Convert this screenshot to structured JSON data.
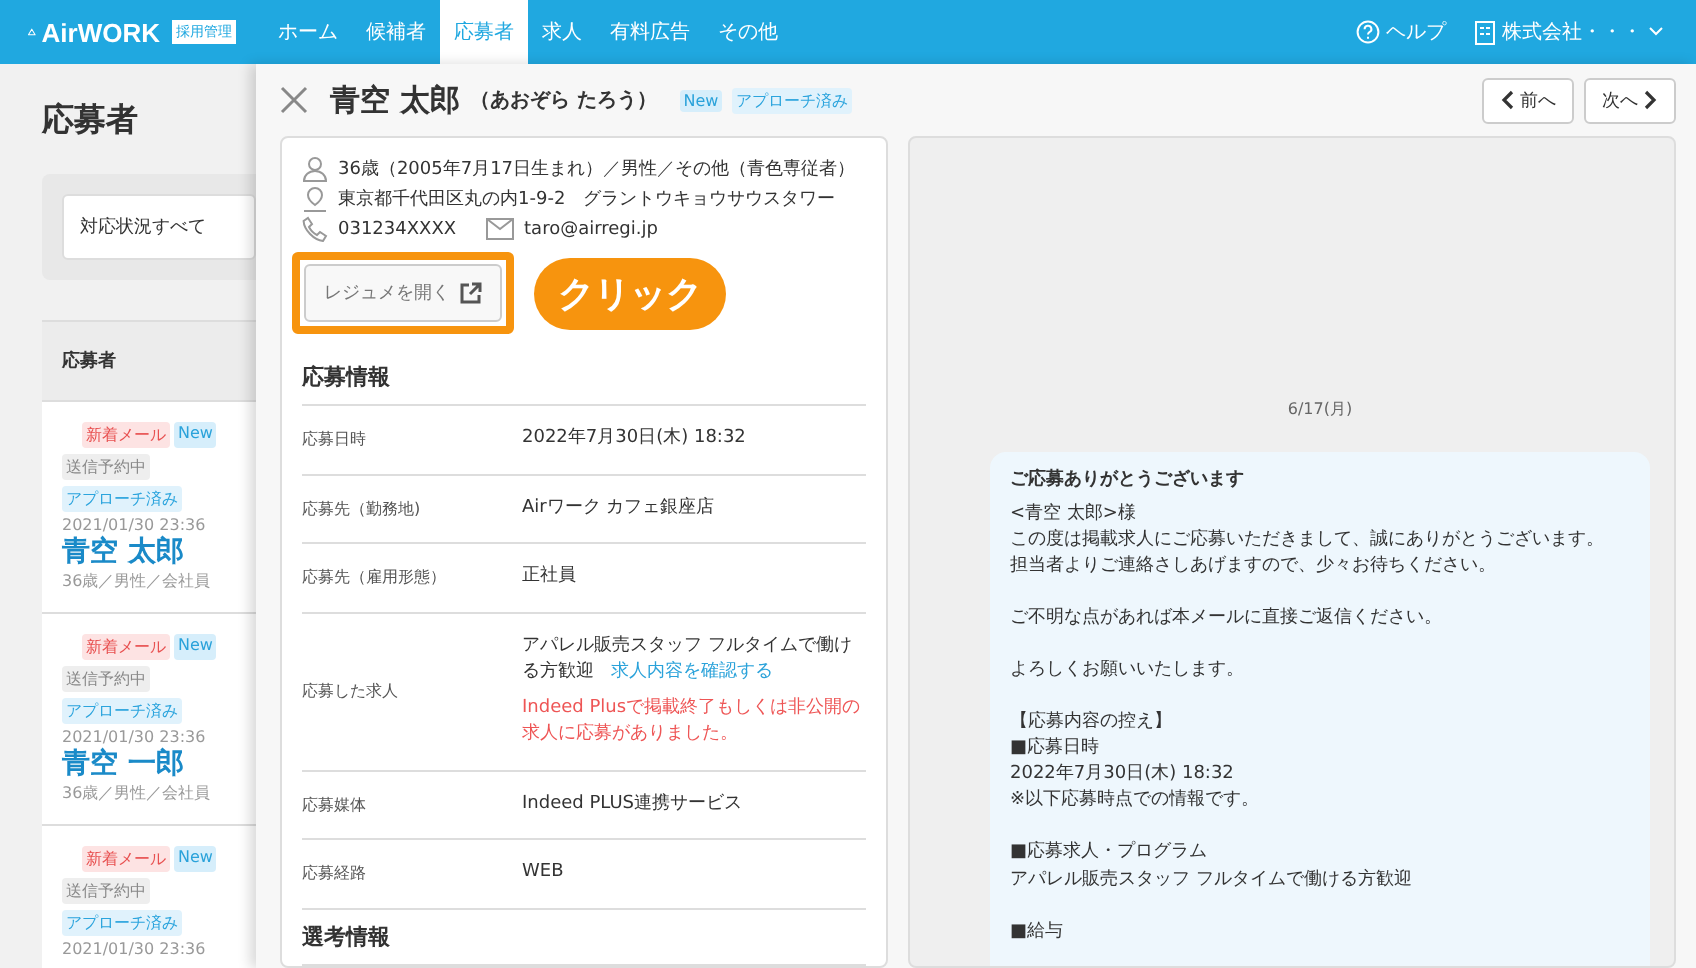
{
  "header": {
    "brand": "AirWORK",
    "brand_tag": "採用管理",
    "nav": [
      {
        "label": "ホーム",
        "selected": false
      },
      {
        "label": "候補者",
        "selected": false
      },
      {
        "label": "応募者",
        "selected": true
      },
      {
        "label": "求人",
        "selected": false
      },
      {
        "label": "有料広告",
        "selected": false
      },
      {
        "label": "その他",
        "selected": false
      }
    ],
    "help": "ヘルプ",
    "account": "株式会社・・・"
  },
  "list": {
    "title": "応募者",
    "filter": "対応状況すべて",
    "column": "応募者",
    "applicants": [
      {
        "tags": [
          {
            "label": "新着メール",
            "kind": "mail"
          },
          {
            "label": "New",
            "kind": "new"
          },
          {
            "label": "送信予約中",
            "kind": "scheduled"
          },
          {
            "label": "アプローチ済み",
            "kind": "approach"
          }
        ],
        "date": "2021/01/30 23:36",
        "name": "青空 太郎",
        "profile": "36歳／男性／会社員"
      },
      {
        "tags": [
          {
            "label": "新着メール",
            "kind": "mail"
          },
          {
            "label": "New",
            "kind": "new"
          },
          {
            "label": "送信予約中",
            "kind": "scheduled"
          },
          {
            "label": "アプローチ済み",
            "kind": "approach"
          }
        ],
        "date": "2021/01/30 23:36",
        "name": "青空 一郎",
        "profile": "36歳／男性／会社員"
      },
      {
        "tags": [
          {
            "label": "新着メール",
            "kind": "mail"
          },
          {
            "label": "New",
            "kind": "new"
          },
          {
            "label": "送信予約中",
            "kind": "scheduled"
          },
          {
            "label": "アプローチ済み",
            "kind": "approach"
          }
        ],
        "date": "2021/01/30 23:36"
      }
    ]
  },
  "detail": {
    "name": "青空 太郎",
    "reading": "（あおぞら たろう）",
    "badges": [
      {
        "label": "New",
        "kind": "new"
      },
      {
        "label": "アプローチ済み",
        "kind": "approach"
      }
    ],
    "prev": "前へ",
    "next": "次へ",
    "profile": "36歳（2005年7月17日生まれ）／男性／その他（青色専従者）",
    "address": "東京都千代田区丸の内1-9-2　グラントウキョウサウスタワー",
    "phone": "031234XXXX",
    "email": "taro@airregi.jp",
    "resume_button": "レジュメを開く",
    "callout": "クリック",
    "section": "応募情報",
    "rows": [
      {
        "label": "応募日時",
        "value": "2022年7月30日(木) 18:32"
      },
      {
        "label": "応募先（勤務地)",
        "value": "Airワーク カフェ銀座店"
      },
      {
        "label": "応募先（雇用形態）",
        "value": "正社員"
      },
      {
        "label": "応募した求人",
        "value": "アパレル販売スタッフ フルタイムで働ける方歓迎",
        "link": "求人内容を確認する",
        "warning": "Indeed Plusで掲載終了もしくは非公開の求人に応募がありました。"
      },
      {
        "label": "応募媒体",
        "value": "Indeed PLUS連携サービス"
      },
      {
        "label": "応募経路",
        "value": "WEB"
      }
    ],
    "next_section": "選考情報"
  },
  "messages": {
    "date": "6/17(月)",
    "title": "ご応募ありがとうございます",
    "paragraphs": [
      [
        "<青空 太郎>様",
        "この度は掲載求人にご応募いただきまして、誠にありがとうございます。",
        "担当者よりご連絡さしあげますので、少々お待ちください。"
      ],
      [
        "ご不明な点があれば本メールに直接ご返信ください。"
      ],
      [
        "よろしくお願いいたします。"
      ],
      [
        "【応募内容の控え】",
        "■応募日時",
        "2022年7月30日(木) 18:32",
        "※以下応募時点での情報です。"
      ],
      [
        "■応募求人・プログラム",
        "アパレル販売スタッフ フルタイムで働ける方歓迎"
      ],
      [
        "■給与"
      ]
    ]
  }
}
